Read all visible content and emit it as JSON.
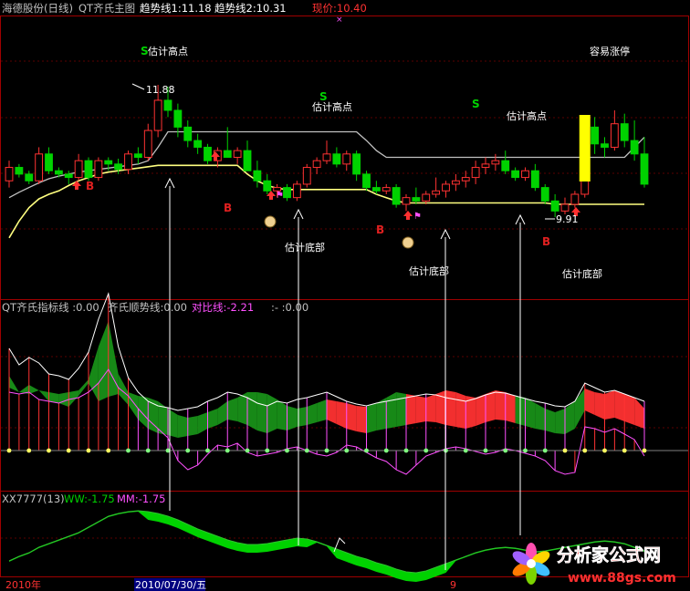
{
  "header": {
    "stock": "海德股份(日线)",
    "indicator": "QT齐氏主图",
    "trend1_label": "趋势线1:11.18",
    "trend2_label": "趋势线2:10.31",
    "price_label": "现价:10.40",
    "marker": "×"
  },
  "panel2": {
    "title": "QT齐氏指标线 :0.00",
    "s1": "齐氏顺势线:0.00",
    "s2": "对比线:-2.21",
    "s3": ":- :0.00"
  },
  "panel3": {
    "title": "XX7777(13)",
    "ww": "WW:-1.75",
    "mm": "MM:-1.75"
  },
  "annotations": {
    "high_estimate": "估计高点",
    "bottom_estimate": "估计底部",
    "easy_limit": "容易涨停",
    "peak": "11.88",
    "trough": "9.91",
    "sell": "S",
    "buy": "B"
  },
  "axis": {
    "year": "2010年",
    "date": "2010/07/30/五",
    "month": "9"
  },
  "watermark": {
    "name": "分析家公式网",
    "url": "www.88gs.com"
  },
  "colors": {
    "up": "#ff3232",
    "down": "#00d200",
    "ma1": "#ffff80",
    "ma2": "#c0c0c0",
    "border": "#a00000",
    "bar_yellow": "#ffff00",
    "purple": "#ff50ff"
  },
  "chart_data": {
    "type": "candlestick",
    "candles": [
      [
        10.45,
        10.75,
        10.35,
        10.65
      ],
      [
        10.65,
        10.7,
        10.5,
        10.55
      ],
      [
        10.55,
        10.6,
        10.4,
        10.45
      ],
      [
        10.45,
        10.95,
        10.4,
        10.85
      ],
      [
        10.85,
        10.95,
        10.55,
        10.6
      ],
      [
        10.6,
        10.65,
        10.5,
        10.55
      ],
      [
        10.55,
        10.6,
        10.4,
        10.5
      ],
      [
        10.5,
        10.85,
        10.45,
        10.75
      ],
      [
        10.75,
        10.8,
        10.45,
        10.5
      ],
      [
        10.5,
        10.8,
        10.45,
        10.75
      ],
      [
        10.75,
        10.8,
        10.6,
        10.7
      ],
      [
        10.7,
        10.78,
        10.55,
        10.62
      ],
      [
        10.62,
        10.9,
        10.55,
        10.85
      ],
      [
        10.85,
        10.95,
        10.7,
        10.8
      ],
      [
        10.8,
        11.3,
        10.75,
        11.2
      ],
      [
        11.2,
        11.88,
        11.1,
        11.65
      ],
      [
        11.65,
        11.85,
        11.4,
        11.5
      ],
      [
        11.5,
        11.6,
        11.1,
        11.25
      ],
      [
        11.25,
        11.35,
        10.95,
        11.05
      ],
      [
        11.05,
        11.15,
        10.85,
        10.95
      ],
      [
        10.95,
        11.0,
        10.7,
        10.75
      ],
      [
        10.75,
        10.95,
        10.65,
        10.9
      ],
      [
        10.9,
        11.25,
        10.8,
        10.8
      ],
      [
        10.8,
        10.95,
        10.7,
        10.9
      ],
      [
        10.9,
        11.05,
        10.6,
        10.6
      ],
      [
        10.6,
        10.75,
        10.35,
        10.45
      ],
      [
        10.45,
        10.55,
        10.25,
        10.3
      ],
      [
        10.3,
        10.4,
        10.2,
        10.35
      ],
      [
        10.35,
        10.4,
        10.15,
        10.2
      ],
      [
        10.2,
        10.45,
        10.15,
        10.4
      ],
      [
        10.4,
        10.7,
        10.35,
        10.65
      ],
      [
        10.65,
        10.8,
        10.55,
        10.75
      ],
      [
        10.75,
        11.05,
        10.7,
        10.85
      ],
      [
        10.85,
        10.95,
        10.65,
        10.7
      ],
      [
        10.7,
        10.9,
        10.6,
        10.85
      ],
      [
        10.85,
        10.9,
        10.45,
        10.55
      ],
      [
        10.55,
        10.6,
        10.3,
        10.35
      ],
      [
        10.35,
        10.45,
        10.25,
        10.3
      ],
      [
        10.3,
        10.4,
        10.25,
        10.35
      ],
      [
        10.35,
        10.4,
        10.05,
        10.1
      ],
      [
        10.1,
        10.25,
        10.0,
        10.2
      ],
      [
        10.2,
        10.35,
        10.1,
        10.15
      ],
      [
        10.15,
        10.3,
        10.1,
        10.25
      ],
      [
        10.25,
        10.5,
        10.2,
        10.3
      ],
      [
        10.3,
        10.45,
        10.2,
        10.4
      ],
      [
        10.4,
        10.55,
        10.3,
        10.45
      ],
      [
        10.45,
        10.6,
        10.35,
        10.5
      ],
      [
        10.5,
        10.75,
        10.4,
        10.65
      ],
      [
        10.65,
        10.8,
        10.55,
        10.7
      ],
      [
        10.7,
        10.85,
        10.6,
        10.75
      ],
      [
        10.75,
        10.9,
        10.55,
        10.6
      ],
      [
        10.6,
        10.65,
        10.45,
        10.5
      ],
      [
        10.5,
        10.65,
        10.45,
        10.6
      ],
      [
        10.6,
        10.7,
        10.3,
        10.35
      ],
      [
        10.35,
        10.4,
        10.1,
        10.15
      ],
      [
        10.15,
        10.25,
        9.91,
        10.0
      ],
      [
        10.0,
        10.2,
        9.95,
        10.1
      ],
      [
        10.1,
        10.3,
        10.05,
        10.25
      ],
      [
        10.25,
        11.3,
        10.2,
        11.25
      ],
      [
        11.25,
        11.4,
        10.85,
        11.0
      ],
      [
        11.0,
        11.1,
        10.8,
        10.95
      ],
      [
        10.95,
        11.5,
        10.9,
        11.3
      ],
      [
        11.3,
        11.45,
        10.95,
        11.05
      ],
      [
        11.05,
        11.35,
        10.75,
        10.85
      ],
      [
        10.85,
        11.1,
        10.35,
        10.4
      ]
    ],
    "series": [
      {
        "name": "趋势线1",
        "values": [
          10.2,
          10.28,
          10.35,
          10.42,
          10.48,
          10.52,
          10.55,
          10.58,
          10.6,
          10.62,
          10.64,
          10.66,
          10.68,
          10.7,
          10.75,
          10.95,
          11.18,
          11.18,
          11.18,
          11.18,
          11.18,
          11.18,
          11.18,
          11.18,
          11.18,
          11.18,
          11.18,
          11.18,
          11.18,
          11.18,
          11.18,
          11.18,
          11.18,
          11.18,
          11.18,
          11.18,
          11.05,
          10.9,
          10.8,
          10.8,
          10.8,
          10.8,
          10.8,
          10.8,
          10.8,
          10.8,
          10.8,
          10.8,
          10.8,
          10.8,
          10.8,
          10.8,
          10.8,
          10.8,
          10.8,
          10.8,
          10.8,
          10.8,
          10.8,
          10.8,
          10.8,
          10.8,
          10.8,
          10.95,
          11.1
        ]
      },
      {
        "name": "趋势线2",
        "values": [
          9.6,
          9.85,
          10.05,
          10.18,
          10.25,
          10.3,
          10.38,
          10.45,
          10.5,
          10.55,
          10.58,
          10.6,
          10.62,
          10.64,
          10.66,
          10.68,
          10.68,
          10.68,
          10.68,
          10.68,
          10.68,
          10.68,
          10.68,
          10.68,
          10.55,
          10.45,
          10.38,
          10.34,
          10.32,
          10.32,
          10.32,
          10.32,
          10.32,
          10.32,
          10.32,
          10.32,
          10.32,
          10.25,
          10.2,
          10.15,
          10.12,
          10.12,
          10.12,
          10.12,
          10.12,
          10.12,
          10.12,
          10.12,
          10.12,
          10.12,
          10.12,
          10.12,
          10.12,
          10.12,
          10.12,
          10.1,
          10.1,
          10.1,
          10.1,
          10.1,
          10.1,
          10.1,
          10.1,
          10.1,
          10.1
        ]
      }
    ]
  }
}
